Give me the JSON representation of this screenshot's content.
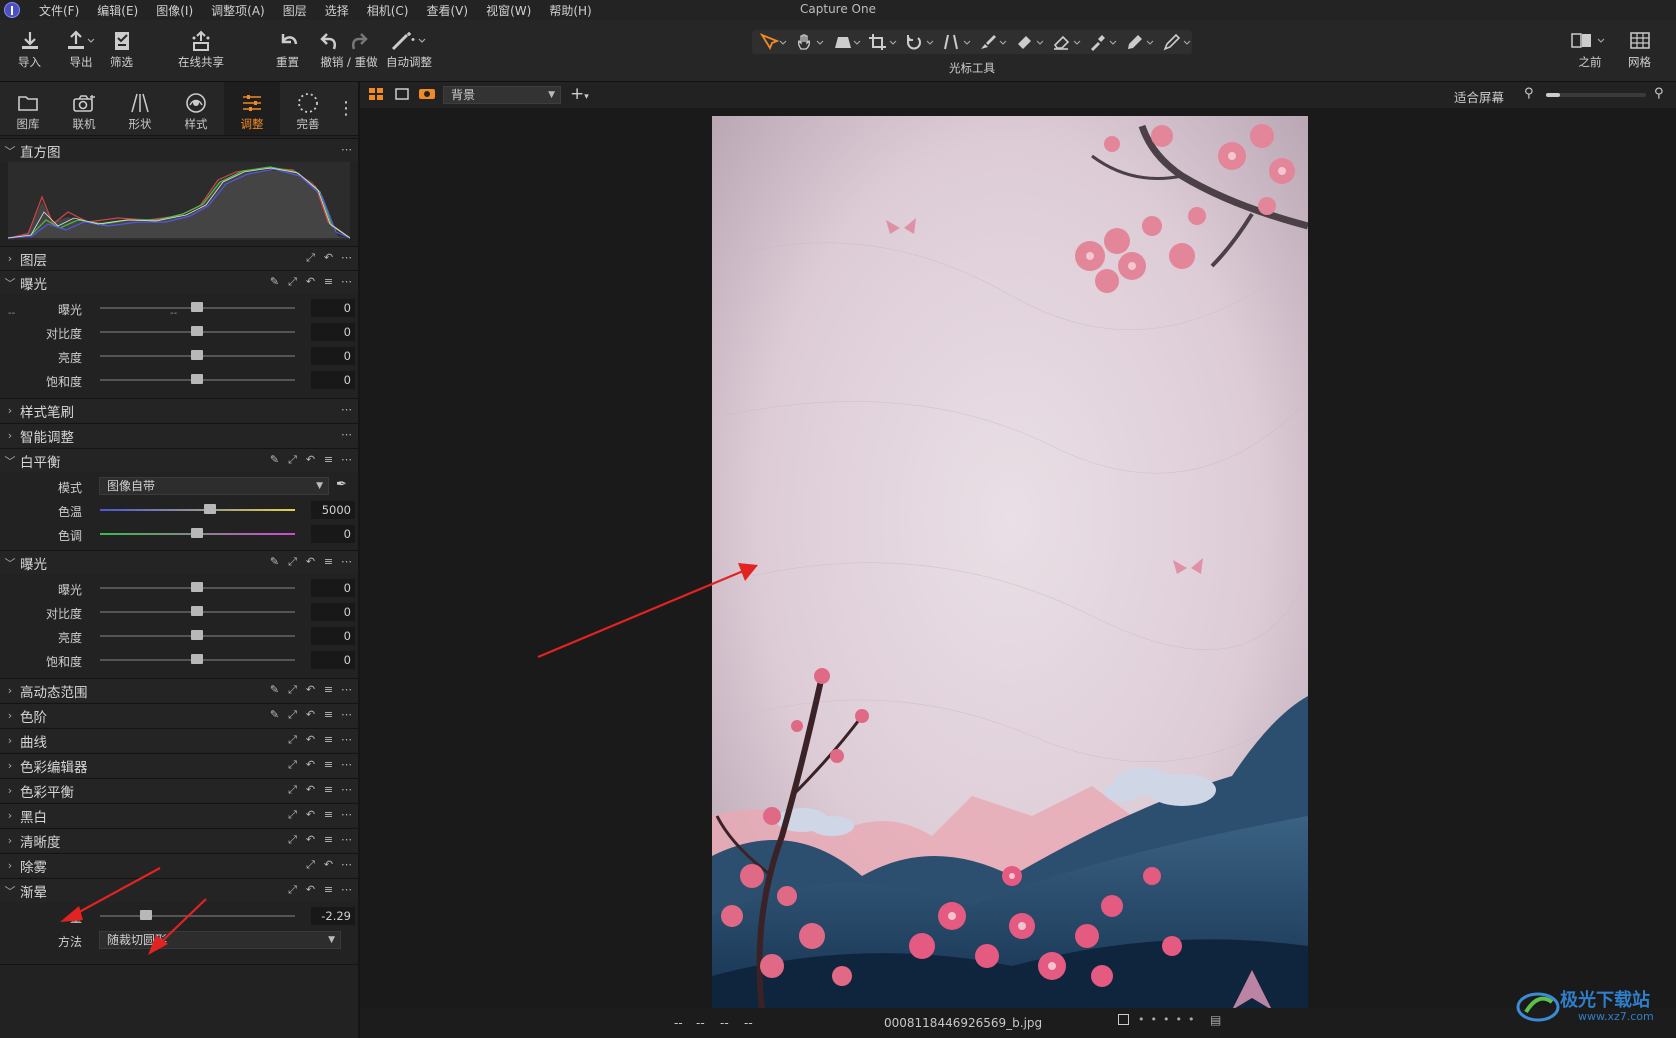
{
  "app": {
    "title": "Capture One"
  },
  "menu": [
    "文件(F)",
    "编辑(E)",
    "图像(I)",
    "调整项(A)",
    "图层",
    "选择",
    "相机(C)",
    "查看(V)",
    "视窗(W)",
    "帮助(H)"
  ],
  "toolbar": {
    "import": "导入",
    "export": "导出",
    "filter": "筛选",
    "share": "在线共享",
    "reset": "重置",
    "undo_redo": "撤销 / 重做",
    "auto_adjust": "自动调整",
    "cursor_tools": "光标工具",
    "before": "之前",
    "grid": "网格"
  },
  "tool_tabs": [
    "图库",
    "联机",
    "形状",
    "样式",
    "调整",
    "完善"
  ],
  "active_tab": "调整",
  "sections": {
    "histogram": "直方图",
    "histogram_ticks": [
      "--",
      "--",
      "--"
    ],
    "layers": "图层",
    "exposure1": {
      "title": "曝光",
      "rows": [
        {
          "label": "曝光",
          "value": "0"
        },
        {
          "label": "对比度",
          "value": "0"
        },
        {
          "label": "亮度",
          "value": "0"
        },
        {
          "label": "饱和度",
          "value": "0"
        }
      ]
    },
    "style_brush": "样式笔刷",
    "smart_adjust": "智能调整",
    "white_balance": {
      "title": "白平衡",
      "mode_label": "模式",
      "mode_value": "图像自带",
      "temp_label": "色温",
      "temp_value": "5000",
      "tint_label": "色调",
      "tint_value": "0"
    },
    "exposure2": {
      "title": "曝光",
      "rows": [
        {
          "label": "曝光",
          "value": "0"
        },
        {
          "label": "对比度",
          "value": "0"
        },
        {
          "label": "亮度",
          "value": "0"
        },
        {
          "label": "饱和度",
          "value": "0"
        }
      ]
    },
    "hdr": "高动态范围",
    "levels": "色阶",
    "curves": "曲线",
    "color_editor": "色彩编辑器",
    "color_balance": "色彩平衡",
    "bw": "黑白",
    "clarity": "清晰度",
    "dehaze": "除雾",
    "vignette": {
      "title": "渐晕",
      "amount_label": "量",
      "amount_value": "-2.29",
      "method_label": "方法",
      "method_value": "随裁切圆形"
    }
  },
  "viewer": {
    "layer_select": "背景",
    "fit_label": "适合屏幕",
    "status_dashes": [
      "--",
      "--",
      "--",
      "--"
    ],
    "filename": "0008118446926569_b.jpg"
  },
  "watermark": {
    "text": "极光下载站",
    "url": "www.xz7.com"
  },
  "colors": {
    "accent": "#f08a24",
    "annotation": "#e32222"
  }
}
